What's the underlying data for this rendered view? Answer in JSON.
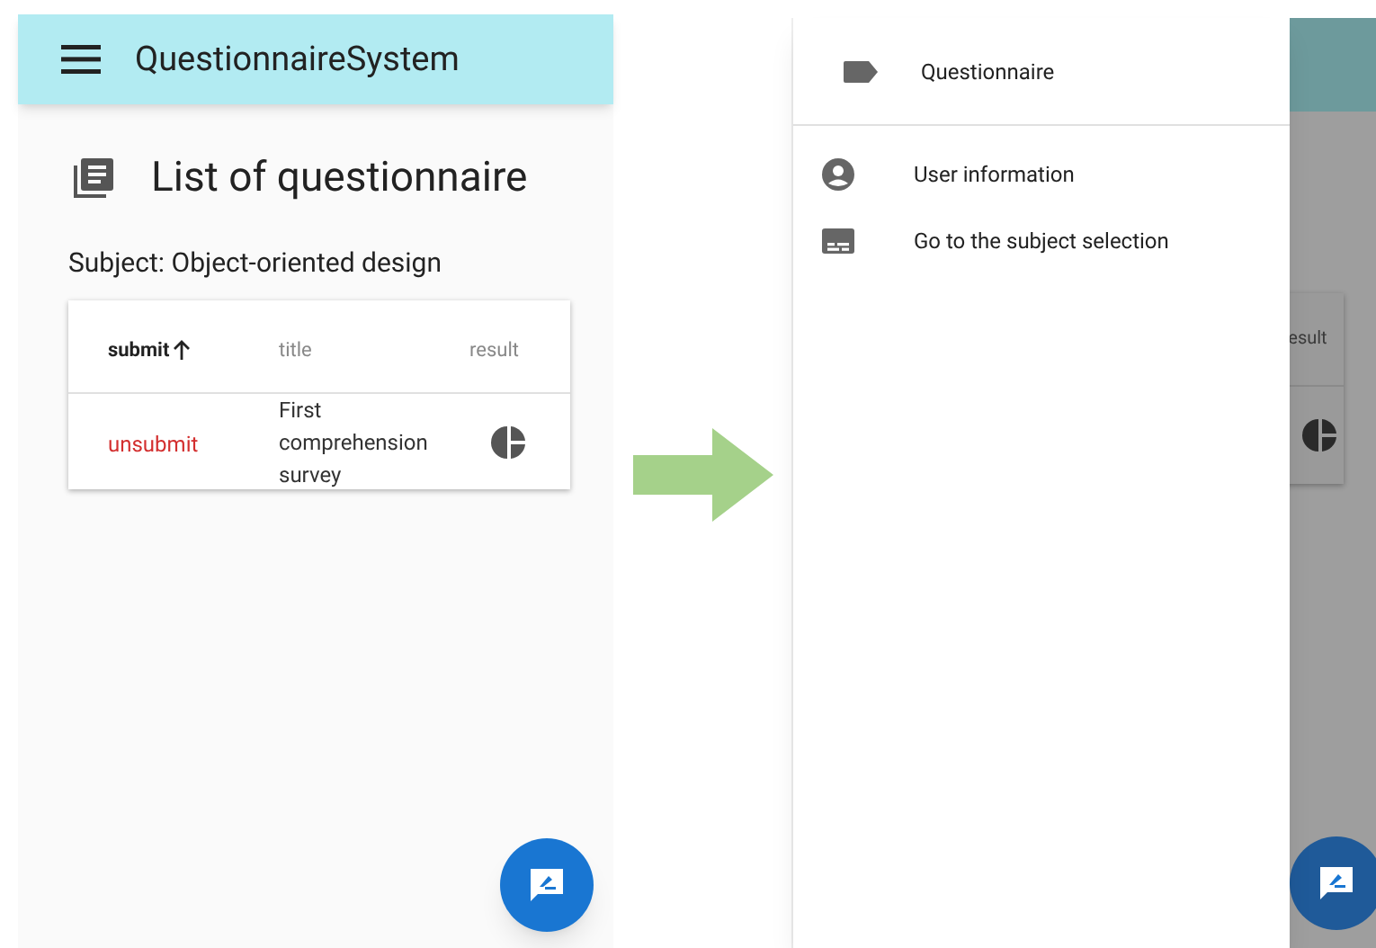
{
  "left_screen": {
    "app_bar": {
      "title": "QuestionnaireSystem"
    },
    "page_title": "List of questionnaire",
    "subject": "Subject: Object-oriented design",
    "table": {
      "columns": [
        {
          "label": "submit",
          "sorted": true
        },
        {
          "label": "title",
          "sorted": false
        },
        {
          "label": "result",
          "sorted": false
        }
      ],
      "rows": [
        {
          "status": "unsubmit",
          "submitted": false,
          "title": "First comprehension survey"
        }
      ]
    }
  },
  "right_screen": {
    "drawer": {
      "header": "Questionnaire",
      "items": [
        {
          "label": "User information",
          "kind": "user"
        },
        {
          "label": "Go to the subject selection",
          "kind": "subject"
        }
      ]
    },
    "background": {
      "column_label": "esult"
    }
  }
}
